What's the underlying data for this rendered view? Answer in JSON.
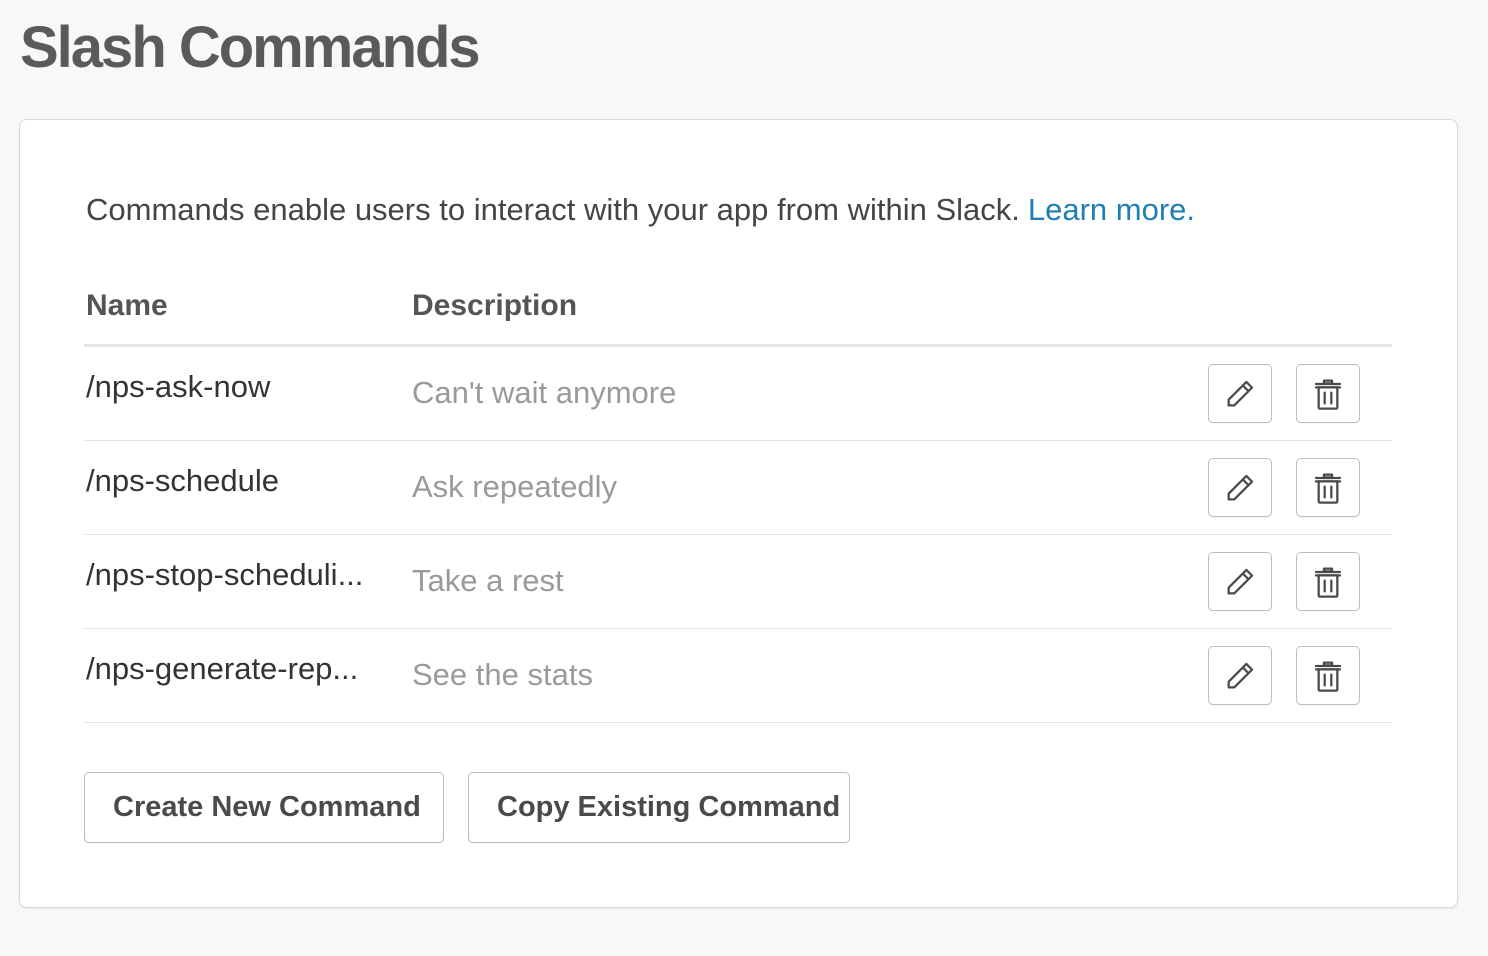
{
  "page": {
    "title": "Slash Commands"
  },
  "intro": {
    "text": "Commands enable users to interact with your app from within Slack.",
    "link_label": "Learn more."
  },
  "table": {
    "headers": {
      "name": "Name",
      "description": "Description"
    },
    "rows": [
      {
        "name": "/nps-ask-now",
        "description": "Can't wait anymore"
      },
      {
        "name": "/nps-schedule",
        "description": "Ask repeatedly"
      },
      {
        "name": "/nps-stop-scheduli...",
        "description": "Take a rest"
      },
      {
        "name": "/nps-generate-rep...",
        "description": "See the stats"
      }
    ],
    "row_actions": {
      "edit_icon": "pencil-icon",
      "delete_icon": "trash-icon"
    }
  },
  "actions": {
    "create_label": "Create New Command",
    "copy_label": "Copy Existing Command"
  },
  "colors": {
    "link": "#1f7fb3",
    "title": "#5a5a5c",
    "description": "#9a9a9c",
    "background": "#f8f8f8"
  }
}
